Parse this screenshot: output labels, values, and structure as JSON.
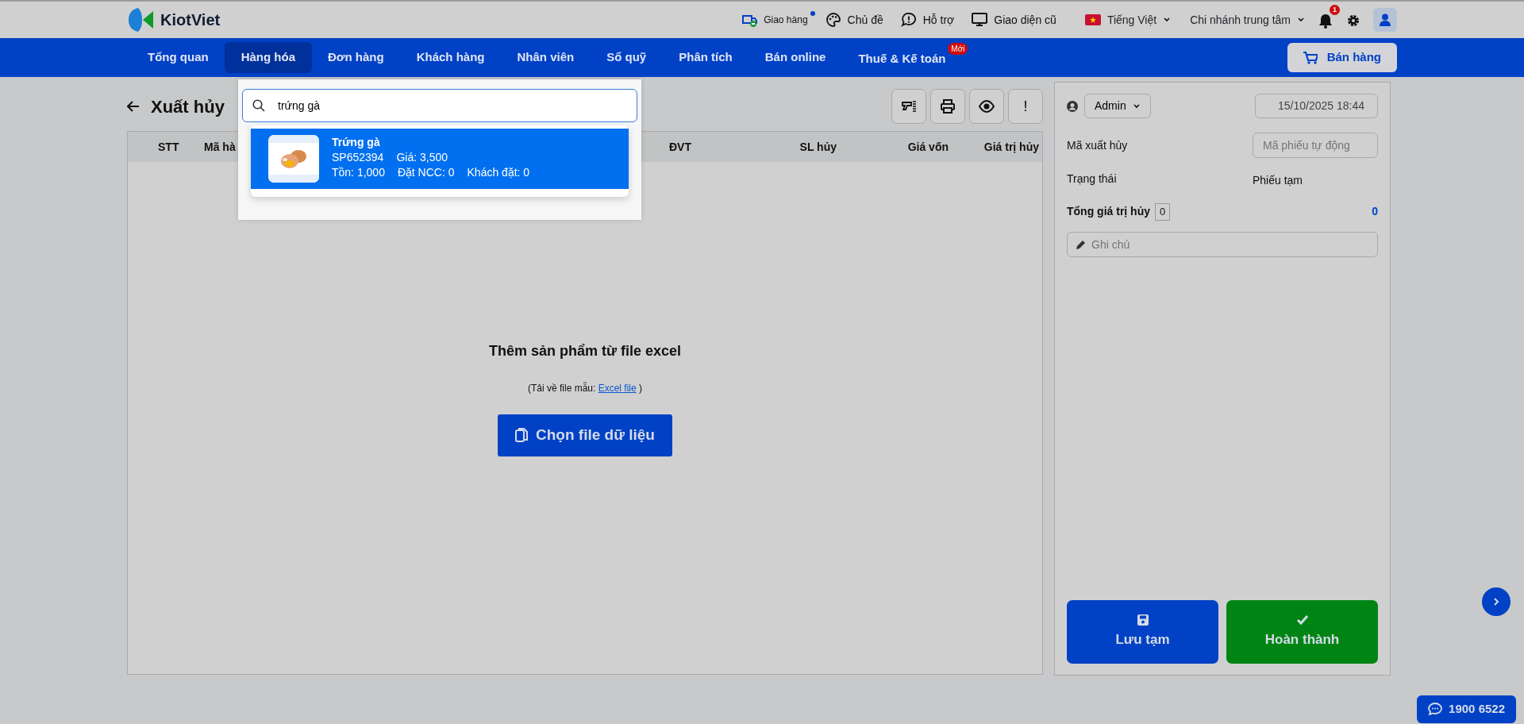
{
  "topbar": {
    "logo": "KiotViet",
    "links": [
      {
        "kind": "delivery",
        "label": "Giao hàng",
        "notify": true
      },
      {
        "kind": "theme",
        "label": "Chủ đề",
        "notify": false
      },
      {
        "kind": "support",
        "label": "Hỗ trợ",
        "notify": false
      },
      {
        "kind": "classic",
        "label": "Giao diện cũ",
        "notify": false
      }
    ],
    "language": "Tiếng Việt",
    "branch": "Chi nhánh trung tâm",
    "notifications": "1"
  },
  "nav": {
    "items": [
      {
        "label": "Tổng quan",
        "selected": false
      },
      {
        "label": "Hàng hóa",
        "selected": true
      },
      {
        "label": "Đơn hàng",
        "selected": false
      },
      {
        "label": "Khách hàng",
        "selected": false
      },
      {
        "label": "Nhân viên",
        "selected": false
      },
      {
        "label": "Sổ quỹ",
        "selected": false
      },
      {
        "label": "Phân tích",
        "selected": false
      },
      {
        "label": "Bán online",
        "selected": false
      },
      {
        "label": "Thuế & Kế toán",
        "selected": false,
        "badge": "Mới"
      }
    ],
    "sell_button": "Bán hàng"
  },
  "page": {
    "title": "Xuất hủy",
    "toolbar": [
      {
        "kind": "scanner"
      },
      {
        "kind": "print"
      },
      {
        "kind": "preview"
      },
      {
        "kind": "text",
        "label": "!"
      }
    ]
  },
  "table": {
    "columns": [
      "STT",
      "Mã hà",
      "ĐVT",
      "SL hủy",
      "Giá vốn",
      "Giá trị hủy"
    ]
  },
  "import": {
    "title": "Thêm sản phẩm từ file excel",
    "hint": "(Tải về file mẫu: ",
    "link": "Excel file",
    "hint_end": " )",
    "button": "Chọn file dữ liệu"
  },
  "search": {
    "value": "trứng gà",
    "results": [
      {
        "name": "Trứng gà",
        "code": "SP652394",
        "price": "Giá: 3,500",
        "stock": "Tồn: 1,000",
        "supplier_order": "Đặt NCC: 0",
        "customer_order": "Khách đặt: 0",
        "selected": true
      }
    ]
  },
  "side": {
    "user": "Admin",
    "date": "15/10/2025 18:44",
    "code_label": "Mã xuất hủy",
    "code_placeholder": "Mã phiếu tự động",
    "status_label": "Trạng thái",
    "status": "Phiếu tạm",
    "total_label": "Tổng giá trị hủy",
    "total_count": "0",
    "total": "0",
    "note_placeholder": "Ghi chú"
  },
  "actions": [
    {
      "kind": "save",
      "label": "Lưu tạm"
    },
    {
      "kind": "complete",
      "label": "Hoàn thành"
    }
  ],
  "hotline": "1900 6522"
}
